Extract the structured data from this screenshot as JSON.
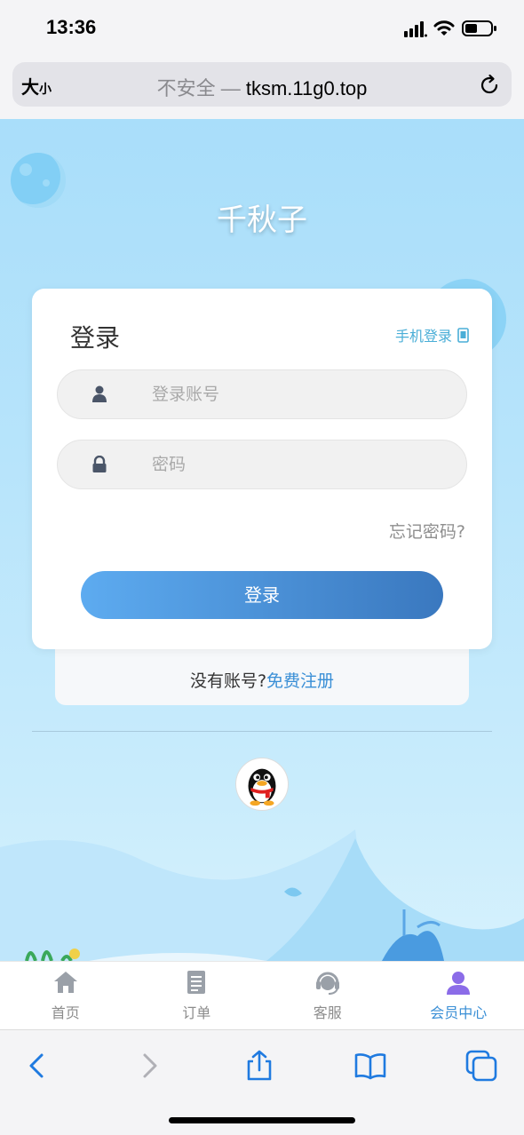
{
  "status_bar": {
    "time": "13:36"
  },
  "browser": {
    "text_size_label": "大",
    "text_size_small": "小",
    "url_insecure": "不安全 —",
    "url_host": "tksm.11g0.top"
  },
  "site": {
    "title": "千秋子"
  },
  "login": {
    "heading": "登录",
    "phone_login_label": "手机登录",
    "account_placeholder": "登录账号",
    "password_placeholder": "密码",
    "forgot_label": "忘记密码?",
    "submit_label": "登录",
    "no_account_text": "没有账号?",
    "register_label": "免费注册"
  },
  "tabs": [
    {
      "label": "首页",
      "icon": "home-icon",
      "active": false
    },
    {
      "label": "订单",
      "icon": "orders-icon",
      "active": false
    },
    {
      "label": "客服",
      "icon": "support-icon",
      "active": false
    },
    {
      "label": "会员中心",
      "icon": "member-icon",
      "active": true
    }
  ],
  "colors": {
    "accent": "#3a8fd6",
    "button_start": "#5dabf0",
    "button_end": "#3a78bf",
    "page_bg": "#a9defa"
  },
  "toolbar": {
    "back": "back-icon",
    "forward": "forward-icon",
    "share": "share-icon",
    "bookmarks": "bookmarks-icon",
    "tabs": "tabs-icon"
  }
}
